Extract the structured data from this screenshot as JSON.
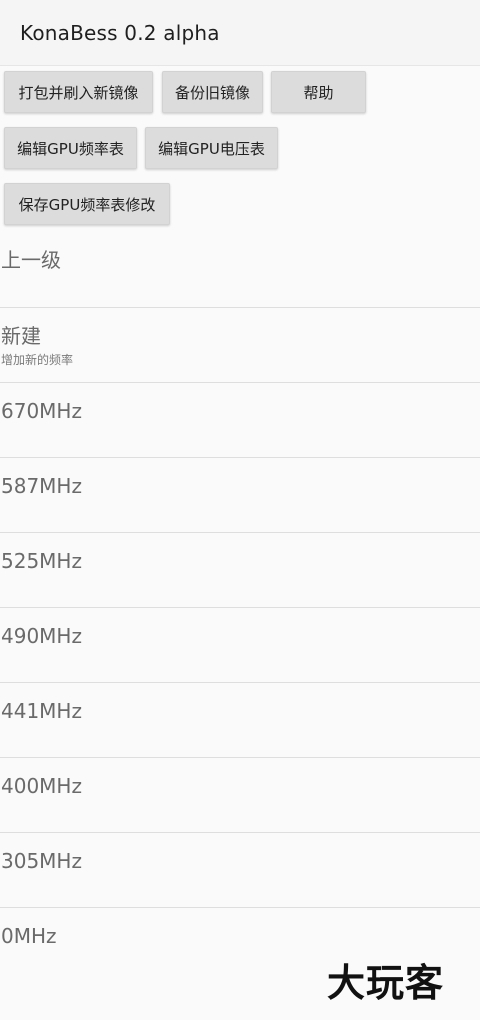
{
  "app": {
    "title": "KonaBess 0.2 alpha"
  },
  "toolbar": {
    "buttons": [
      {
        "label": "打包并刷入新镜像"
      },
      {
        "label": "备份旧镜像"
      },
      {
        "label": "帮助"
      },
      {
        "label": "编辑GPU频率表"
      },
      {
        "label": "编辑GPU电压表"
      },
      {
        "label": "保存GPU频率表修改"
      }
    ]
  },
  "list": {
    "back": {
      "title": "上一级"
    },
    "new": {
      "title": "新建",
      "subtitle": "增加新的频率"
    },
    "frequencies": [
      "670MHz",
      "587MHz",
      "525MHz",
      "490MHz",
      "441MHz",
      "400MHz",
      "305MHz",
      "0MHz"
    ]
  },
  "watermark": {
    "text": "大玩客"
  }
}
